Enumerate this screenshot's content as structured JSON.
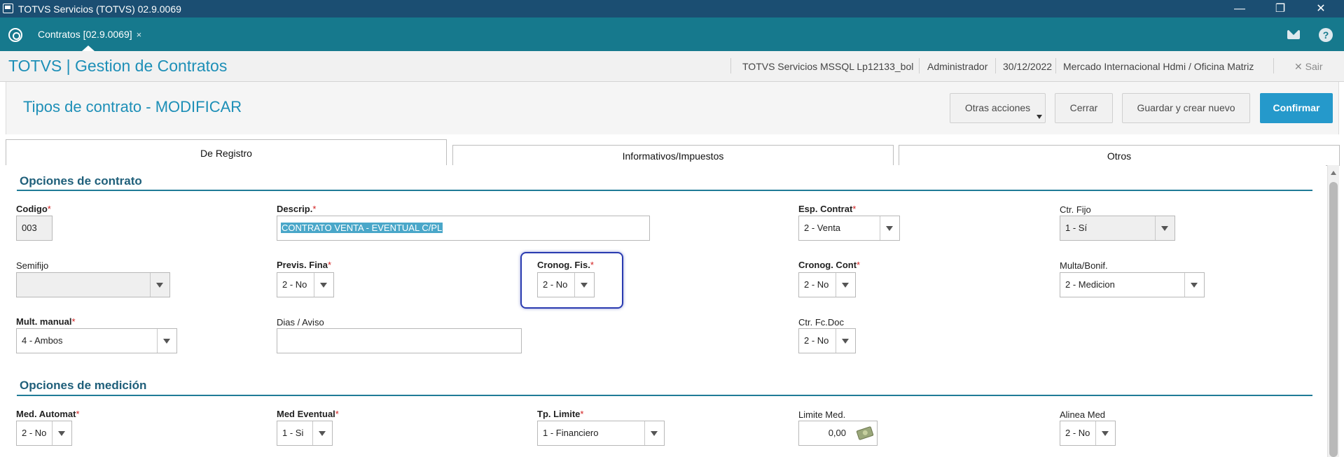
{
  "window": {
    "title": "TOTVS Servicios (TOTVS) 02.9.0069",
    "minimize_glyph": "—",
    "maximize_glyph": "❐",
    "close_glyph": "✕"
  },
  "tabbar": {
    "active_tab": "Contratos [02.9.0069]",
    "close_glyph": "×"
  },
  "app": {
    "title": "TOTVS | Gestion de Contratos",
    "environment": "TOTVS Servicios MSSQL Lp12133_bol",
    "user": "Administrador",
    "date": "30/12/2022",
    "branch": "Mercado Internacional Hdmi / Oficina Matriz",
    "exit_label": "Sair",
    "exit_glyph": "✕"
  },
  "page": {
    "title": "Tipos de contrato - MODIFICAR",
    "buttons": {
      "other_actions": "Otras acciones",
      "close": "Cerrar",
      "save_new": "Guardar y crear nuevo",
      "confirm": "Confirmar"
    }
  },
  "folders": [
    "De Registro",
    "Informativos/Impuestos",
    "Otros"
  ],
  "sections": {
    "contract_options": "Opciones de contrato",
    "measurement_options": "Opciones de medición"
  },
  "fields": {
    "codigo": {
      "label": "Codigo",
      "value": "003",
      "required": "*"
    },
    "descrip": {
      "label": "Descrip.",
      "value": "CONTRATO VENTA - EVENTUAL C/PL",
      "required": "*"
    },
    "esp_contrat": {
      "label": "Esp. Contrat",
      "value": "2 - Venta",
      "required": "*"
    },
    "ctr_fijo": {
      "label": "Ctr. Fijo",
      "value": "1 - Sí"
    },
    "semifijo": {
      "label": "Semifijo",
      "value": ""
    },
    "previs_fina": {
      "label": "Previs. Fina",
      "value": "2 - No",
      "required": "*"
    },
    "cronog_fis": {
      "label": "Cronog. Fis.",
      "value": "2 - No",
      "required": "*"
    },
    "cronog_cont": {
      "label": "Cronog. Cont",
      "value": "2 - No",
      "required": "*"
    },
    "multa_bonif": {
      "label": "Multa/Bonif.",
      "value": "2 - Medicion"
    },
    "mult_manual": {
      "label": "Mult. manual",
      "value": "4 - Ambos",
      "required": "*"
    },
    "dias_aviso": {
      "label": "Dias / Aviso",
      "value": ""
    },
    "ctr_fc_doc": {
      "label": "Ctr. Fc.Doc",
      "value": "2 - No"
    },
    "med_automat": {
      "label": "Med. Automat",
      "value": "2 - No",
      "required": "*"
    },
    "med_eventual": {
      "label": "Med Eventual",
      "value": "1 - Si",
      "required": "*"
    },
    "tp_limite": {
      "label": "Tp. Limite",
      "value": "1 - Financiero",
      "required": "*"
    },
    "limite_med": {
      "label": "Limite Med.",
      "value": "0,00"
    },
    "alinea_med": {
      "label": "Alinea Med",
      "value": "2 - No"
    }
  }
}
